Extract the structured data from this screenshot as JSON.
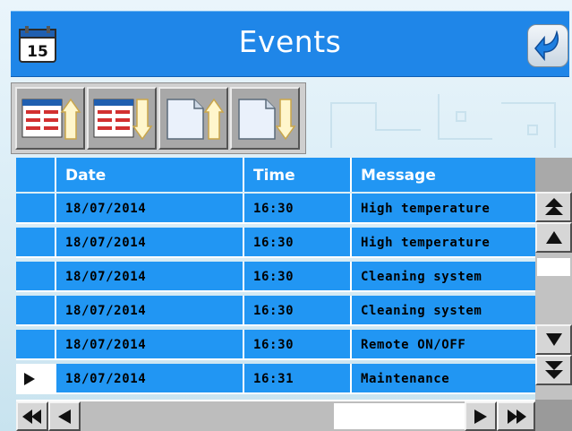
{
  "header": {
    "title": "Events",
    "calendar_day": "15",
    "accent": "#1f86e8"
  },
  "toolbar": {
    "buttons": [
      {
        "icon": "sort-table-up-icon"
      },
      {
        "icon": "sort-table-down-icon"
      },
      {
        "icon": "page-up-icon"
      },
      {
        "icon": "page-down-icon"
      }
    ]
  },
  "table": {
    "columns": [
      "Date",
      "Time",
      "Message"
    ],
    "rows": [
      {
        "date": "18/07/2014",
        "time": "16:30",
        "message": "High temperature"
      },
      {
        "date": "18/07/2014",
        "time": "16:30",
        "message": "High temperature"
      },
      {
        "date": "18/07/2014",
        "time": "16:30",
        "message": "Cleaning system"
      },
      {
        "date": "18/07/2014",
        "time": "16:30",
        "message": "Cleaning system"
      },
      {
        "date": "18/07/2014",
        "time": "16:30",
        "message": "Remote ON/OFF"
      },
      {
        "date": "18/07/2014",
        "time": "16:31",
        "message": "Maintenance"
      }
    ],
    "selected_row": 6,
    "row_color": "#2196f3"
  },
  "scroll": {
    "vertical_buttons": [
      "double-up-icon",
      "up-icon",
      "down-icon",
      "double-down-icon"
    ],
    "horizontal_buttons": [
      "double-left-icon",
      "left-icon",
      "right-icon",
      "double-right-icon"
    ]
  }
}
